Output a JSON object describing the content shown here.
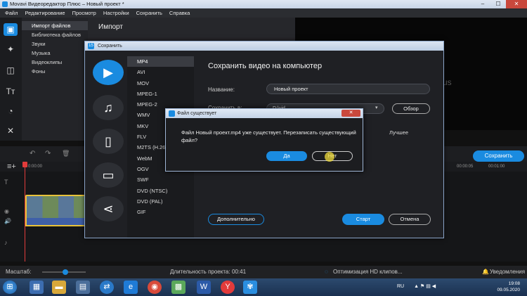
{
  "window": {
    "title": "Movavi Видеоредактор Плюс – Новый проект *"
  },
  "menu": [
    "Файл",
    "Редактирование",
    "Просмотр",
    "Настройки",
    "Сохранить",
    "Справка"
  ],
  "subnav": {
    "items": [
      "Импорт файлов",
      "Библиотека файлов",
      "Звуки",
      "Музыка",
      "Видеоклипы",
      "Фоны"
    ]
  },
  "import_panel": {
    "title": "Импорт"
  },
  "preview": {
    "watermark": "us"
  },
  "timeline": {
    "save_label": "Сохранить",
    "ruler_ticks": [
      "0:00:00",
      "00:00:05",
      "00:01:00"
    ]
  },
  "statusbar": {
    "scale_label": "Масштаб:",
    "duration_label": "Длительность проекта:",
    "duration_value": "00:41",
    "optimization": "Оптимизация HD клипов...",
    "notifications": "Уведомления"
  },
  "save_dialog": {
    "title": "Сохранить",
    "heading": "Сохранить видео на компьютер",
    "formats": [
      "MP4",
      "AVI",
      "MOV",
      "MPEG-1",
      "MPEG-2",
      "WMV",
      "MKV",
      "FLV",
      "M2TS (H.264)",
      "WebM",
      "OGV",
      "SWF",
      "DVD (NTSC)",
      "DVD (PAL)",
      "GIF"
    ],
    "selected_format": "MP4",
    "name_label": "Название:",
    "name_value": "Новый проект",
    "saveto_label": "Сохранить в:",
    "saveto_value": "D:\\vid",
    "browse_label": "Обзор",
    "quality_label": "Лучшее",
    "advanced_label": "Дополнительно",
    "start_label": "Старт",
    "cancel_label": "Отмена"
  },
  "exists_dialog": {
    "title": "Файл существует",
    "message": "Файл Новый проект.mp4 уже существует. Перезаписать существующий файл?",
    "yes_label": "Да",
    "no_label": "Нет",
    "close_glyph": "✕"
  },
  "taskbar": {
    "language": "RU",
    "time": "19:08",
    "date": "09.05.2020"
  }
}
